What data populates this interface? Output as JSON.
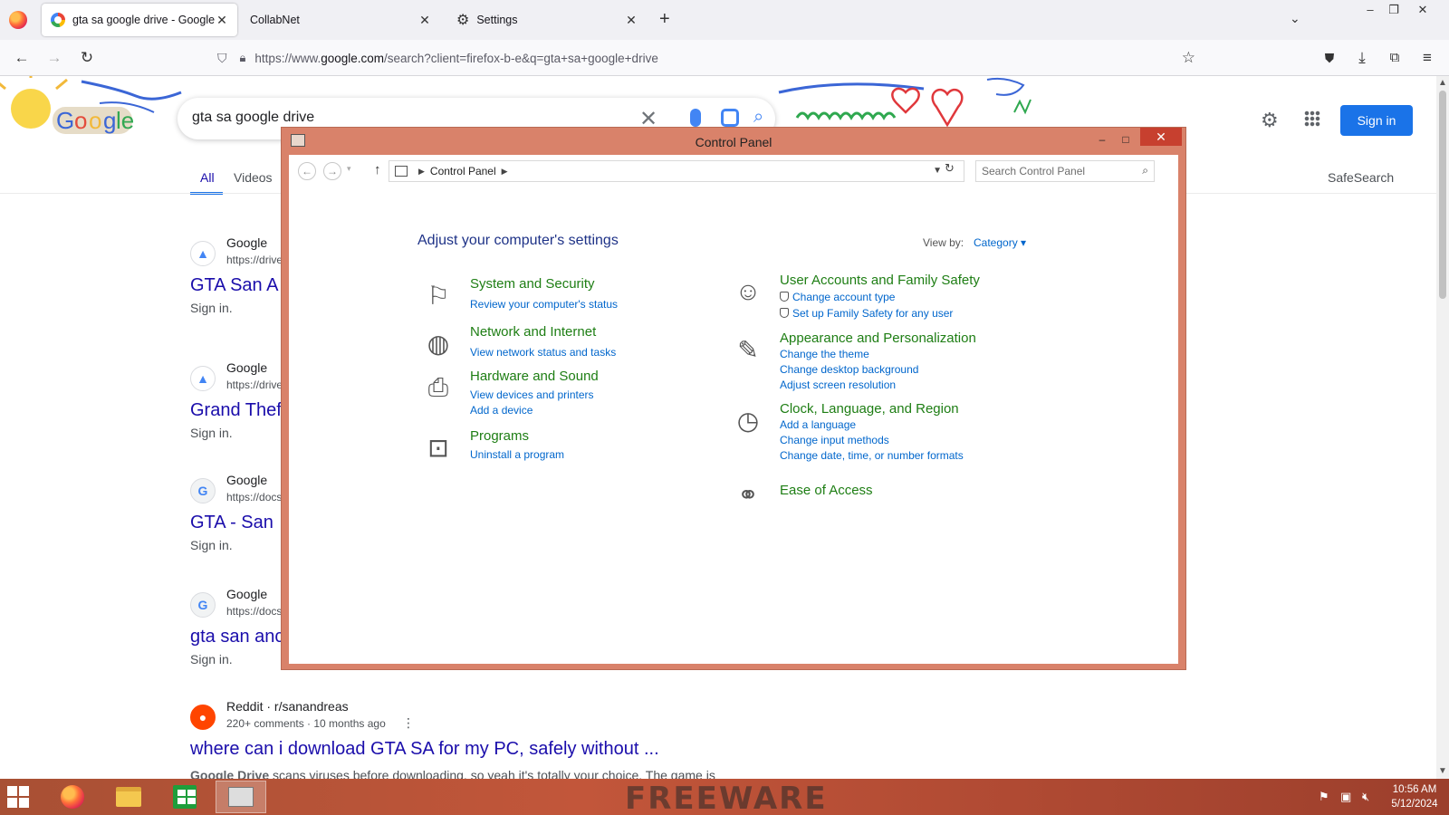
{
  "browser": {
    "tabs": [
      {
        "title": "gta sa google drive - Google Se",
        "active": true
      },
      {
        "title": "CollabNet",
        "active": false
      },
      {
        "title": "Settings",
        "active": false
      }
    ],
    "url_prefix": "https://www.",
    "url_domain": "google.com",
    "url_rest": "/search?client=firefox-b-e&q=gta+sa+google+drive"
  },
  "google": {
    "query": "gta sa google drive",
    "tabs": {
      "all": "All",
      "videos": "Videos"
    },
    "safesearch": "SafeSearch",
    "signin": "Sign in",
    "results": [
      {
        "site": "Google",
        "url": "https://drive",
        "title": "GTA San A",
        "snippet": "Sign in."
      },
      {
        "site": "Google",
        "url": "https://drive",
        "title": "Grand Thef",
        "snippet": "Sign in."
      },
      {
        "site": "Google",
        "url": "https://docs",
        "title": "GTA - San",
        "snippet": "Sign in."
      },
      {
        "site": "Google",
        "url": "https://docs",
        "title": "gta san anc",
        "snippet": "Sign in."
      }
    ],
    "reddit": {
      "site": "Reddit · r/sanandreas",
      "meta": "220+ comments · 10 months ago",
      "title": "where can i download GTA SA for my PC, safely without ...",
      "snippet_bold": "Google Drive",
      "snippet": " scans viruses before downloading, so yeah it's totally your choice. The game is"
    }
  },
  "control_panel": {
    "title": "Control Panel",
    "breadcrumb": "Control Panel",
    "search_placeholder": "Search Control Panel",
    "heading": "Adjust your computer's settings",
    "view_by_label": "View by:",
    "view_by_value": "Category",
    "categories": {
      "system": {
        "title": "System and Security",
        "links": [
          "Review your computer's status"
        ]
      },
      "network": {
        "title": "Network and Internet",
        "links": [
          "View network status and tasks"
        ]
      },
      "hardware": {
        "title": "Hardware and Sound",
        "links": [
          "View devices and printers",
          "Add a device"
        ]
      },
      "programs": {
        "title": "Programs",
        "links": [
          "Uninstall a program"
        ]
      },
      "users": {
        "title": "User Accounts and Family Safety",
        "links": [
          "Change account type",
          "Set up Family Safety for any user"
        ]
      },
      "appearance": {
        "title": "Appearance and Personalization",
        "links": [
          "Change the theme",
          "Change desktop background",
          "Adjust screen resolution"
        ]
      },
      "clock": {
        "title": "Clock, Language, and Region",
        "links": [
          "Add a language",
          "Change input methods",
          "Change date, time, or number formats"
        ]
      },
      "ease": {
        "title": "Ease of Access",
        "links": []
      }
    }
  },
  "taskbar": {
    "watermark": "FREEWARE",
    "time": "10:56 AM",
    "date": "5/12/2024"
  }
}
